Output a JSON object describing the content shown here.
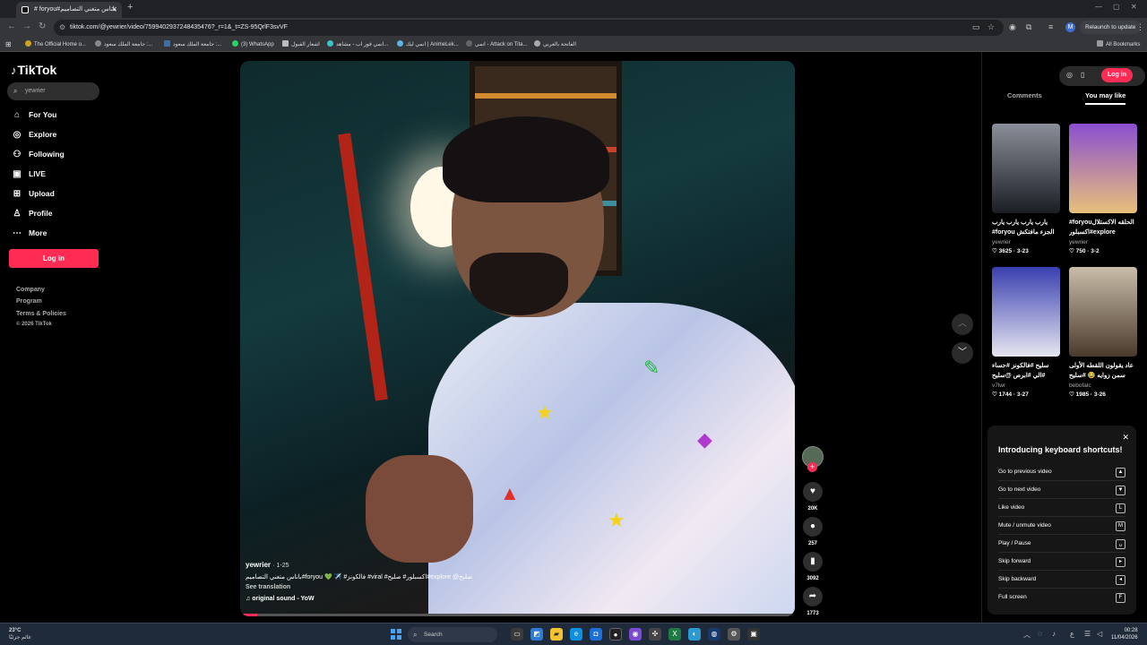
{
  "browser": {
    "tab_title": "# foryou#باناس متعني التصاميم",
    "url": "tiktok.com/@yewrier/video/7599402937248435476?_r=1&_t=ZS-95QrlF3svVF",
    "relaunch_label": "Relaunch to update",
    "profile_initial": "M",
    "all_bookmarks": "All Bookmarks",
    "bookmarks": [
      "The Official Home o...",
      "جامعة الملك سعود :...",
      "جامعة الملك سعود :...",
      "(3) WhatsApp",
      "اشعار القبول",
      "انمي فور اب - مشاهد...",
      "انمي ليك | AnimeLek...",
      "انمي - Attack on Tita...",
      "الفاتحة بالعربي"
    ]
  },
  "sidebar": {
    "logo": "TikTok",
    "search_value": "yewrier",
    "nav": [
      {
        "label": "For You",
        "icon": "home-icon"
      },
      {
        "label": "Explore",
        "icon": "compass-icon"
      },
      {
        "label": "Following",
        "icon": "following-icon"
      },
      {
        "label": "LIVE",
        "icon": "live-icon"
      },
      {
        "label": "Upload",
        "icon": "upload-icon"
      },
      {
        "label": "Profile",
        "icon": "profile-icon"
      },
      {
        "label": "More",
        "icon": "more-icon"
      }
    ],
    "login_label": "Log in",
    "footer": [
      "Company",
      "Program",
      "Terms & Policies",
      "© 2026 TikTok"
    ]
  },
  "video": {
    "username": "yewrier",
    "date": "· 1-25",
    "description": "صليح@ explore#اكسبلور# صليح# viral# فالكونز# ✈️ 💚 foryou#باناس متعني التصاميم",
    "see_translation": "See translation",
    "sound": "original sound - YoW",
    "progress": 0.03
  },
  "actions": {
    "likes": "20K",
    "comments": "257",
    "saves": "3092",
    "shares": "1773"
  },
  "right_panel": {
    "login_label": "Log in",
    "tabs": [
      "Comments",
      "You may like"
    ],
    "cards": [
      {
        "title": "يارب يارب يارب يارب الجزء مافتكش foryou#",
        "author": "yewrier",
        "meta": "♡ 3625 · 3-23",
        "color": "#2c2f38"
      },
      {
        "title": "#foryouالحلقه الاكستلال #اكسبلورexplore",
        "author": "yewrier",
        "meta": "♡ 750 · 3-2",
        "color": "#6a3aa0"
      },
      {
        "title": "سليح #فالكونز #حساء #الي #ابرص @سليح",
        "author": "v7lwr",
        "meta": "♡ 1744 · 3-27",
        "color": "#3b3f9c"
      },
      {
        "title": "عاد يقولون اللقطه الأولى سمن زوايه 😂 #سليح",
        "author": "bebofalc",
        "meta": "♡ 1985 · 3-26",
        "color": "#8a7a68"
      }
    ]
  },
  "shortcuts": {
    "title": "Introducing keyboard shortcuts!",
    "items": [
      {
        "label": "Go to previous video",
        "key": "▲"
      },
      {
        "label": "Go to next video",
        "key": "▼"
      },
      {
        "label": "Like video",
        "key": "L"
      },
      {
        "label": "Mute / unmute video",
        "key": "M"
      },
      {
        "label": "Play / Pause",
        "key": "␣"
      },
      {
        "label": "Skip forward",
        "key": "▸"
      },
      {
        "label": "Skip backward",
        "key": "◂"
      },
      {
        "label": "Full screen",
        "key": "F"
      }
    ]
  },
  "taskbar": {
    "temp": "23°C",
    "weather_text": "غائم جزئيًا",
    "search_placeholder": "Search",
    "time": "00:28",
    "date": "11/04/2026",
    "lang": "ع"
  }
}
